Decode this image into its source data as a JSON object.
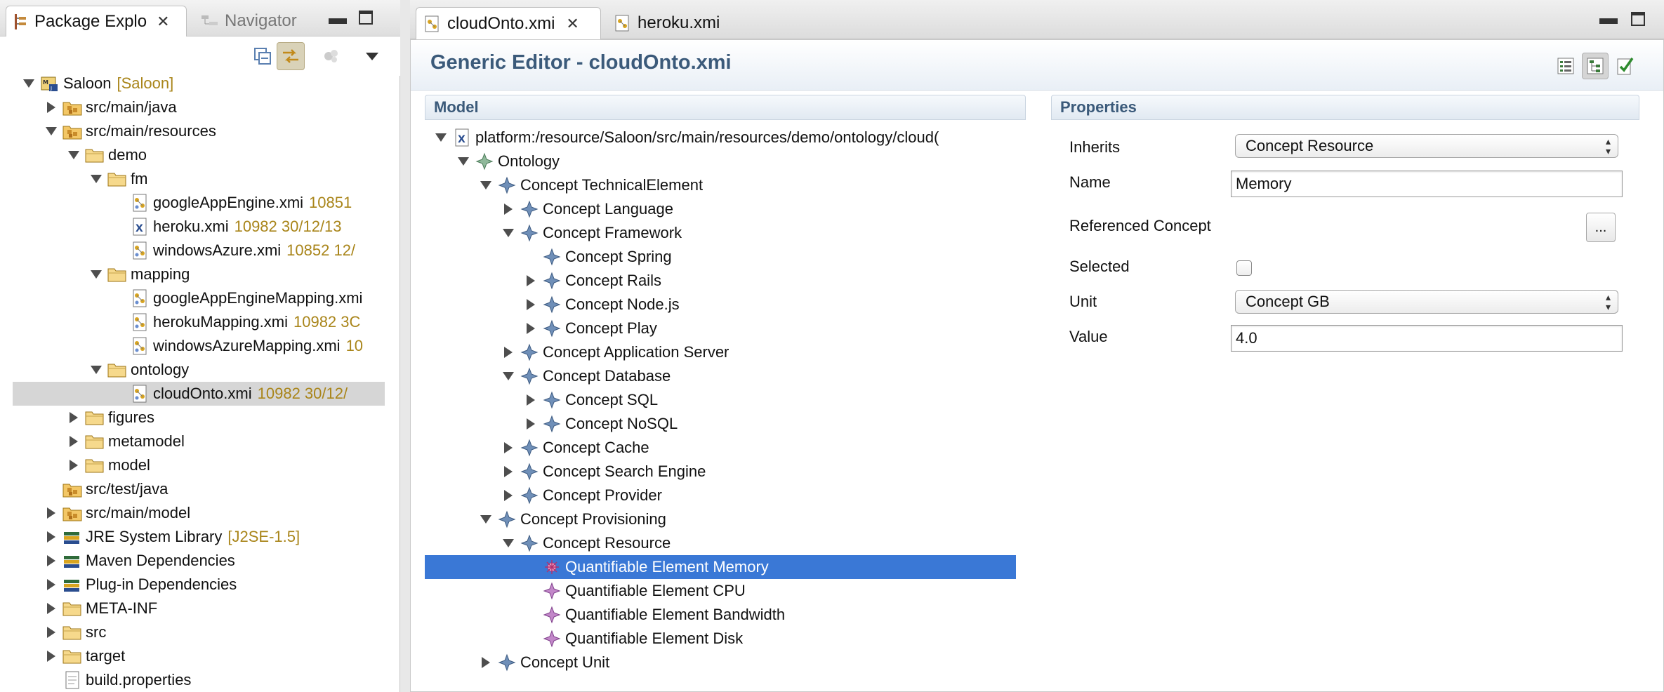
{
  "left_panel": {
    "tabs": [
      {
        "label": "Package Explo"
      },
      {
        "label": "Navigator"
      }
    ],
    "tree": [
      {
        "label": "Saloon",
        "decor": "[Saloon]",
        "icon": "project-icon"
      },
      {
        "label": "src/main/java",
        "icon": "source-folder-icon"
      },
      {
        "label": "src/main/resources",
        "icon": "source-folder-icon"
      },
      {
        "label": "demo",
        "icon": "folder-icon"
      },
      {
        "label": "fm",
        "icon": "folder-icon"
      },
      {
        "label": "googleAppEngine.xmi",
        "decor": "10851",
        "icon": "xmi-file-icon"
      },
      {
        "label": "heroku.xmi",
        "decor": "10982  30/12/13",
        "icon": "xml-file-icon"
      },
      {
        "label": "windowsAzure.xmi",
        "decor": "10852  12/",
        "icon": "xmi-file-icon"
      },
      {
        "label": "mapping",
        "icon": "folder-icon"
      },
      {
        "label": "googleAppEngineMapping.xmi",
        "icon": "xmi-file-icon"
      },
      {
        "label": "herokuMapping.xmi",
        "decor": "10982  3C",
        "icon": "xmi-file-icon"
      },
      {
        "label": "windowsAzureMapping.xmi",
        "decor": "10",
        "icon": "xmi-file-icon"
      },
      {
        "label": "ontology",
        "icon": "folder-icon"
      },
      {
        "label": "cloudOnto.xmi",
        "decor": "10982  30/12/",
        "icon": "xmi-file-icon"
      },
      {
        "label": "figures",
        "icon": "folder-icon"
      },
      {
        "label": "metamodel",
        "icon": "folder-icon"
      },
      {
        "label": "model",
        "icon": "folder-icon"
      },
      {
        "label": "src/test/java",
        "icon": "source-folder-icon"
      },
      {
        "label": "src/main/model",
        "icon": "source-folder-icon"
      },
      {
        "label": "JRE System Library",
        "decor": "[J2SE-1.5]",
        "icon": "library-icon"
      },
      {
        "label": "Maven Dependencies",
        "icon": "library-icon"
      },
      {
        "label": "Plug-in Dependencies",
        "icon": "library-icon"
      },
      {
        "label": "META-INF",
        "icon": "folder-icon"
      },
      {
        "label": "src",
        "icon": "folder-icon"
      },
      {
        "label": "target",
        "icon": "folder-icon"
      },
      {
        "label": "build.properties",
        "icon": "properties-file-icon"
      }
    ]
  },
  "editor": {
    "tabs": [
      {
        "label": "cloudOnto.xmi"
      },
      {
        "label": "heroku.xmi"
      }
    ],
    "title": "Generic Editor - cloudOnto.xmi",
    "model_header": "Model",
    "properties_header": "Properties",
    "model_tree": [
      {
        "label": "platform:/resource/Saloon/src/main/resources/demo/ontology/cloud("
      },
      {
        "label": "Ontology"
      },
      {
        "label": "Concept TechnicalElement"
      },
      {
        "label": "Concept Language"
      },
      {
        "label": "Concept Framework"
      },
      {
        "label": "Concept Spring"
      },
      {
        "label": "Concept Rails"
      },
      {
        "label": "Concept Node.js"
      },
      {
        "label": "Concept Play"
      },
      {
        "label": "Concept Application Server"
      },
      {
        "label": "Concept Database"
      },
      {
        "label": "Concept SQL"
      },
      {
        "label": "Concept NoSQL"
      },
      {
        "label": "Concept Cache"
      },
      {
        "label": "Concept Search Engine"
      },
      {
        "label": "Concept Provider"
      },
      {
        "label": "Concept Provisioning"
      },
      {
        "label": "Concept Resource"
      },
      {
        "label": "Quantifiable Element Memory"
      },
      {
        "label": "Quantifiable Element CPU"
      },
      {
        "label": "Quantifiable Element Bandwidth"
      },
      {
        "label": "Quantifiable Element Disk"
      },
      {
        "label": "Concept Unit"
      }
    ],
    "properties": {
      "inherits_label": "Inherits",
      "inherits_value": "Concept Resource",
      "name_label": "Name",
      "name_value": "Memory",
      "referenced_label": "Referenced Concept",
      "referenced_button": "...",
      "selected_label": "Selected",
      "unit_label": "Unit",
      "unit_value": "Concept GB",
      "value_label": "Value",
      "value_value": "4.0"
    }
  },
  "colors": {
    "selection_blue": "#3a78d6",
    "header_text": "#3b5a7a",
    "decoration": "#a9851a"
  }
}
